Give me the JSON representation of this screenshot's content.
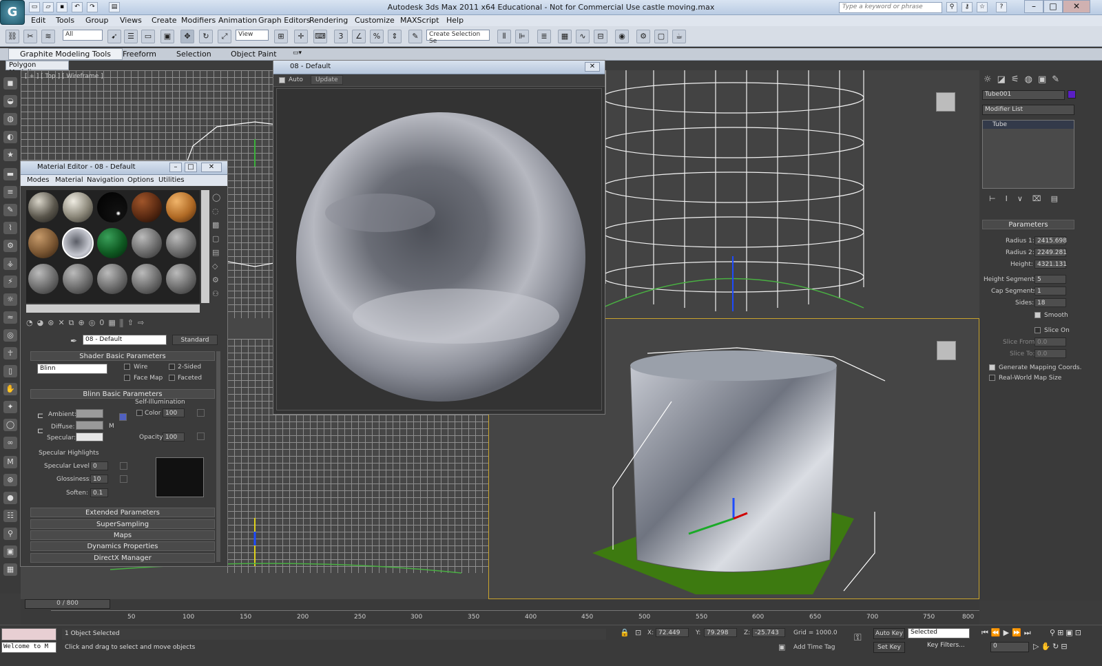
{
  "app": {
    "title": "Autodesk 3ds Max  2011 x64    Educational  - Not for Commercial Use    castle moving.max",
    "search_placeholder": "Type a keyword or phrase",
    "logo": "G"
  },
  "menu": [
    "Edit",
    "Tools",
    "Group",
    "Views",
    "Create",
    "Modifiers",
    "Animation",
    "Graph Editors",
    "Rendering",
    "Customize",
    "MAXScript",
    "Help"
  ],
  "toolbar": {
    "filter": "All",
    "coord": "View",
    "selection_set": "Create Selection Se"
  },
  "ribbon": {
    "tabs": [
      "Graphite Modeling Tools",
      "Freeform",
      "Selection",
      "Object Paint"
    ],
    "sub": "Polygon Modeling"
  },
  "viewport": {
    "top_left_label": "[ + ] [ Top ] [ Wireframe ]"
  },
  "render_window": {
    "title": "08 - Default",
    "auto": "Auto",
    "update": "Update"
  },
  "mat_editor": {
    "title": "Material Editor - 08 - Default",
    "menus": [
      "Modes",
      "Material",
      "Navigation",
      "Options",
      "Utilities"
    ],
    "material_name": "08 - Default",
    "material_type": "Standard",
    "shader_title": "Shader Basic Parameters",
    "shader": "Blinn",
    "wire": "Wire",
    "two_sided": "2-Sided",
    "face_map": "Face Map",
    "faceted": "Faceted",
    "blinn_title": "Blinn Basic Parameters",
    "self_illum": "Self-Illumination",
    "color": "Color",
    "color_val": "100",
    "ambient": "Ambient:",
    "diffuse": "Diffuse:",
    "specular": "Specular:",
    "m": "M",
    "opacity": "Opacity:",
    "opacity_val": "100",
    "spec_hi": "Specular Highlights",
    "spec_level": "Specular Level:",
    "spec_level_val": "0",
    "gloss": "Glossiness:",
    "gloss_val": "10",
    "soften": "Soften:",
    "soften_val": "0.1",
    "rollouts": [
      "Extended Parameters",
      "SuperSampling",
      "Maps",
      "Dynamics Properties",
      "DirectX Manager"
    ]
  },
  "cmd": {
    "object_name": "Tube001",
    "modifier_list": "Modifier List",
    "stack_item": "Tube",
    "params_title": "Parameters",
    "params": [
      {
        "label": "Radius 1:",
        "value": "2415.698"
      },
      {
        "label": "Radius 2:",
        "value": "2249.281"
      },
      {
        "label": "Height:",
        "value": "4321.131"
      },
      {
        "label": "Height Segments:",
        "value": "5"
      },
      {
        "label": "Cap Segments:",
        "value": "1"
      },
      {
        "label": "Sides:",
        "value": "18"
      }
    ],
    "smooth": "Smooth",
    "slice_on": "Slice On",
    "slice_from": "Slice From:",
    "slice_from_val": "0.0",
    "slice_to": "Slice To:",
    "slice_to_val": "0.0",
    "gen_map": "Generate Mapping Coords.",
    "real_world": "Real-World Map Size"
  },
  "timeline": {
    "frame": "0 / 800",
    "ticks": [
      "50",
      "100",
      "150",
      "200",
      "250",
      "300",
      "350",
      "400",
      "450",
      "500",
      "550",
      "600",
      "650",
      "700",
      "750",
      "800"
    ]
  },
  "status": {
    "maxscript": "Welcome to M",
    "selected": "1 Object Selected",
    "prompt": "Click and drag to select and move objects",
    "x_label": "X:",
    "x": "72.449",
    "y_label": "Y:",
    "y": "79.298",
    "z_label": "Z:",
    "z": "-25.743",
    "grid": "Grid = 1000.0",
    "add_time_tag": "Add Time Tag",
    "auto_key": "Auto Key",
    "set_key": "Set Key",
    "key_mode": "Selected",
    "key_filters": "Key Filters...",
    "frame_val": "0"
  }
}
